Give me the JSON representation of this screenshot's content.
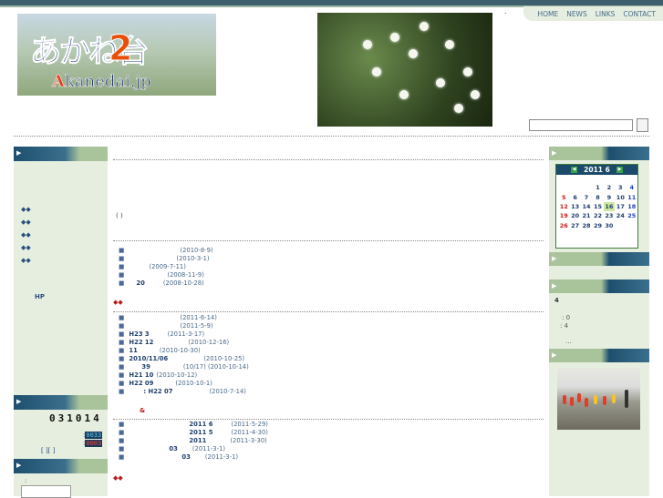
{
  "nav": {
    "home": "HOME",
    "news": "NEWS",
    "links": "LINKS",
    "contact": "CONTACT",
    "dot": "."
  },
  "logo": {
    "kana": "あかね台",
    "num": "2",
    "url_a": "A",
    "url_rest": "kanedai.jp"
  },
  "left": {
    "menu": [
      "◆◆",
      "◆◆",
      "◆◆",
      "◆◆",
      "◆◆"
    ],
    "hp": "HP",
    "counter": "031014",
    "today_prefix": ":",
    "today_val": "0033",
    "yesterday_prefix": ":",
    "yesterday_val": "0003",
    "brackets": "[   ][     ]",
    "search_colon": ":"
  },
  "main": {
    "paren": "(                         )",
    "list1": [
      {
        "text": "",
        "date": "(2010-8-9)"
      },
      {
        "text": "",
        "date": "(2010-3-1)"
      },
      {
        "text": "",
        "date": "(2009-7-11)"
      },
      {
        "text": "",
        "date": "(2008-11-9)"
      },
      {
        "text": "20",
        "date": "(2008-10-28)"
      }
    ],
    "sec2_marker": "◆◆",
    "list2": [
      {
        "text": "",
        "date": "(2011-6-14)"
      },
      {
        "text": "",
        "date": "(2011-5-9)"
      },
      {
        "text": "H23 3",
        "date": "(2011-3-17)"
      },
      {
        "text": "H22 12",
        "date": "(2010-12-16)"
      },
      {
        "text": "11",
        "date": "(2010-10-30)"
      },
      {
        "text": "2010/11/06",
        "date": "(2010-10-25)"
      },
      {
        "text": "39",
        "date": "(10/17) (2010-10-14)"
      },
      {
        "text": "H21   10",
        "date": "(2010-10-12)"
      },
      {
        "text": "H22 09",
        "date": "(2010-10-1)"
      },
      {
        "text": ": H22 07",
        "date": "(2010-7-14)"
      }
    ],
    "amp": "&",
    "list3": [
      {
        "text": "2011  6",
        "date": "(2011-5-29)"
      },
      {
        "text": "2011  5",
        "date": "(2011-4-30)"
      },
      {
        "text": "2011",
        "date": "(2011-3-30)"
      },
      {
        "text": "03",
        "date": "(2011-3-1)"
      },
      {
        "text": "03",
        "date": "(2011-3-1)"
      }
    ],
    "sec4_marker": "◆◆"
  },
  "right": {
    "cal_title": "2011  6",
    "cal_prev": "◀",
    "cal_next": "▶",
    "cal_rows": [
      [
        "",
        "",
        "",
        "1",
        "2",
        "3",
        "4"
      ],
      [
        "5",
        "6",
        "7",
        "8",
        "9",
        "10",
        "11"
      ],
      [
        "12",
        "13",
        "14",
        "15",
        "16",
        "17",
        "18"
      ],
      [
        "19",
        "20",
        "21",
        "22",
        "23",
        "24",
        "25"
      ],
      [
        "26",
        "27",
        "28",
        "29",
        "30",
        "",
        ""
      ]
    ],
    "today": "16",
    "num4": "4",
    "stat1": ": 0",
    "stat2": ": 4",
    "ellipsis": "..."
  }
}
